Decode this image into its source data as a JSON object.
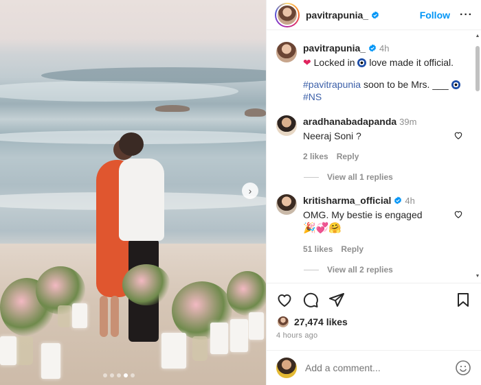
{
  "post": {
    "author": "pavitrapunia_",
    "follow_label": "Follow",
    "more_label": "···",
    "caption": {
      "author": "pavitrapunia_",
      "time": "4h",
      "line1": "Locked in",
      "line1_end": "love made it official.",
      "hashtag1": "#pavitrapunia",
      "middle": "soon to be Mrs. ___",
      "hashtag2": "#NS"
    },
    "likes": "27,474 likes",
    "time_ago": "4 hours ago"
  },
  "comments": [
    {
      "author": "aradhanabadapanda",
      "time": "39m",
      "text": "Neeraj Soni ?",
      "likes": "2 likes",
      "reply": "Reply",
      "view_replies": "View all 1 replies"
    },
    {
      "author": "kritisharma_official",
      "time": "4h",
      "text": "OMG. My bestie is engaged",
      "emoji": "🎉💞🤗",
      "likes": "51 likes",
      "reply": "Reply",
      "view_replies": "View all 2 replies"
    }
  ],
  "add_comment": {
    "placeholder": "Add a comment..."
  },
  "carousel": {
    "next_label": "›",
    "slides": 5,
    "active_slide": 4
  },
  "colors": {
    "accent": "#0095f6",
    "verified": "#0095f6",
    "hashtag": "#3b5fa8",
    "muted": "#8e8e8e"
  },
  "icons": [
    "like-icon",
    "comment-icon",
    "share-icon",
    "save-icon",
    "emoji-icon",
    "verified-icon",
    "heart-icon"
  ]
}
